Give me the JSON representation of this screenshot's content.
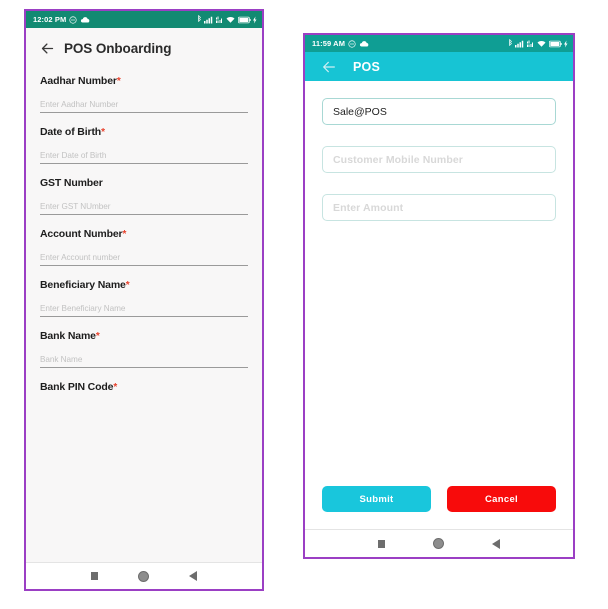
{
  "left_phone": {
    "status_bar": {
      "time": "12:02 PM",
      "left_icons": [
        "dnd-icon",
        "weather-cloud-icon"
      ],
      "right_icons": [
        "bluetooth-icon",
        "signal-bars-icon",
        "mobile-data-icon",
        "wifi-icon",
        "battery-icon",
        "charging-bolt-icon"
      ],
      "battery_level": "100",
      "background_color": "#128a72"
    },
    "header": {
      "back_label": "back-arrow",
      "title": "POS Onboarding"
    },
    "fields": [
      {
        "label": "Aadhar Number",
        "required": true,
        "value": "",
        "placeholder": "Enter Aadhar Number"
      },
      {
        "label": "Date of Birth",
        "required": true,
        "value": "",
        "placeholder": "Enter Date of Birth"
      },
      {
        "label": "GST Number",
        "required": false,
        "value": "",
        "placeholder": "Enter GST NUmber"
      },
      {
        "label": "Account Number",
        "required": true,
        "value": "",
        "placeholder": "Enter Account number"
      },
      {
        "label": "Beneficiary Name",
        "required": true,
        "value": "",
        "placeholder": "Enter Beneficiary Name"
      },
      {
        "label": "Bank Name",
        "required": true,
        "value": "",
        "placeholder": "Bank Name"
      },
      {
        "label": "Bank PIN Code",
        "required": true,
        "value": "",
        "placeholder": ""
      }
    ],
    "required_marker": "*",
    "nav_bar": [
      "recents-square-icon",
      "home-circle-icon",
      "back-triangle-icon"
    ]
  },
  "right_phone": {
    "status_bar": {
      "time": "11:59 AM",
      "left_icons": [
        "dnd-icon",
        "weather-cloud-icon"
      ],
      "right_icons": [
        "bluetooth-icon",
        "signal-bars-icon",
        "mobile-data-icon",
        "wifi-icon",
        "battery-icon",
        "charging-bolt-icon"
      ],
      "battery_level": "100",
      "background_color": "#0f9e94"
    },
    "app_bar": {
      "back_label": "back-arrow",
      "title": "POS",
      "background_color": "#17c4d4"
    },
    "inputs": [
      {
        "name": "transaction-type",
        "value": "Sale@POS",
        "placeholder": ""
      },
      {
        "name": "customer-mobile",
        "value": "",
        "placeholder": "Customer Mobile Number"
      },
      {
        "name": "amount",
        "value": "",
        "placeholder": "Enter Amount"
      }
    ],
    "buttons": {
      "submit": {
        "label": "Submit",
        "color": "#19c6dc"
      },
      "cancel": {
        "label": "Cancel",
        "color": "#f80b0b"
      }
    },
    "nav_bar": [
      "recents-square-icon",
      "home-circle-icon",
      "back-triangle-icon"
    ]
  }
}
